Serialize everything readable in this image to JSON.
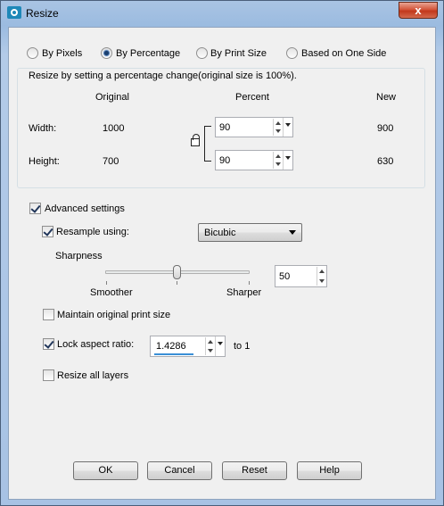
{
  "window": {
    "title": "Resize",
    "close_label": "x"
  },
  "mode": {
    "options": [
      "By Pixels",
      "By Percentage",
      "By Print Size",
      "Based on One Side"
    ],
    "selected": "By Percentage"
  },
  "group": {
    "caption": "Resize by setting a percentage change(original size is 100%).",
    "col_original": "Original",
    "col_percent": "Percent",
    "col_new": "New",
    "width": {
      "label": "Width:",
      "original": "1000",
      "percent": "90",
      "new": "900"
    },
    "height": {
      "label": "Height:",
      "original": "700",
      "percent": "90",
      "new": "630"
    }
  },
  "advanced": {
    "label": "Advanced settings",
    "checked": true,
    "resample_label": "Resample using:",
    "resample_checked": true,
    "resample_value": "Bicubic",
    "sharpness_label": "Sharpness",
    "smoother_label": "Smoother",
    "sharper_label": "Sharper",
    "sharpness_value": "50",
    "maintain_label": "Maintain original print size",
    "maintain_checked": false,
    "lock_label": "Lock aspect ratio:",
    "lock_checked": true,
    "ratio_value": "1.4286",
    "ratio_suffix": "to 1",
    "resize_layers_label": "Resize all layers",
    "resize_layers_checked": false
  },
  "buttons": {
    "ok": "OK",
    "cancel": "Cancel",
    "reset": "Reset",
    "help": "Help"
  }
}
